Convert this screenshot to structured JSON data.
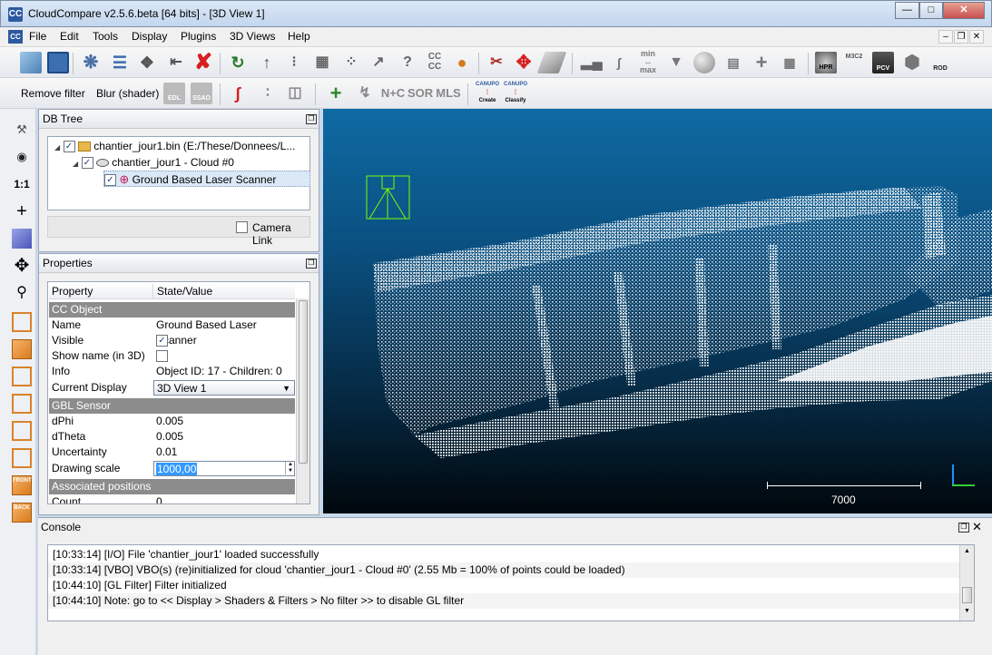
{
  "window": {
    "app_icon": "CC",
    "title": "CloudCompare v2.5.6.beta [64 bits] - [3D View 1]",
    "controls": [
      "minimize-icon",
      "maximize-icon",
      "close-icon"
    ]
  },
  "menu": {
    "items": [
      "File",
      "Edit",
      "Tools",
      "Display",
      "Plugins",
      "3D Views",
      "Help"
    ]
  },
  "toolbar2": {
    "remove_filter": "Remove filter",
    "blur": "Blur (shader)",
    "edl": "EDL",
    "ssao": "SSAO",
    "n_c": "N+C",
    "sor": "SOR",
    "mls": "MLS",
    "canupo_create": "Create",
    "canupo_classify": "Classify",
    "canupo": "CANUPO"
  },
  "toolbar1": {
    "hpr": "HPR",
    "m3c2": "M3C2",
    "pcv": "PCV",
    "rod": "ROD",
    "min": "min",
    "max": "max"
  },
  "left_toolbar": {
    "ratio_label": "1:1",
    "front": "FRONT",
    "back": "BACK"
  },
  "db_tree": {
    "title": "DB Tree",
    "items": [
      {
        "label": "chantier_jour1.bin (E:/These/Donnees/L...",
        "checked": true
      },
      {
        "label": "chantier_jour1 - Cloud #0",
        "checked": true
      },
      {
        "label": "Ground Based Laser Scanner",
        "checked": true
      }
    ],
    "camera_link": "Camera Link"
  },
  "properties": {
    "title": "Properties",
    "col_property": "Property",
    "col_value": "State/Value",
    "sections": {
      "cc_object": "CC Object",
      "gbl_sensor": "GBL Sensor",
      "associated": "Associated positions"
    },
    "rows": {
      "name_k": "Name",
      "name_v": "Ground Based Laser Scanner",
      "visible_k": "Visible",
      "showname_k": "Show name (in 3D)",
      "info_k": "Info",
      "info_v": "Object ID: 17 - Children: 0",
      "display_k": "Current Display",
      "display_v": "3D View 1",
      "dphi_k": "dPhi",
      "dphi_v": "0.005",
      "dtheta_k": "dTheta",
      "dtheta_v": "0.005",
      "unc_k": "Uncertainty",
      "unc_v": "0.01",
      "scale_k": "Drawing scale",
      "scale_v": "1000,00",
      "count_k": "Count",
      "count_v": "0"
    }
  },
  "view3d": {
    "scale_label": "7000"
  },
  "console": {
    "title": "Console",
    "lines": [
      "[10:33:14] [I/O] File 'chantier_jour1' loaded successfully",
      "[10:33:14] [VBO] VBO(s) (re)initialized for cloud 'chantier_jour1 - Cloud #0' (2.55 Mb = 100% of points could be loaded)",
      "[10:44:10] [GL Filter] Filter initialized",
      "[10:44:10] Note: go to << Display > Shaders & Filters > No filter >> to disable GL filter"
    ]
  },
  "colors": {
    "accent": "#2c5aa0",
    "section_gray": "#8c8c8c",
    "sensor_green": "#7cfc00",
    "view_bg_top": "#0e6aa3",
    "view_bg_bottom": "#01070c"
  }
}
